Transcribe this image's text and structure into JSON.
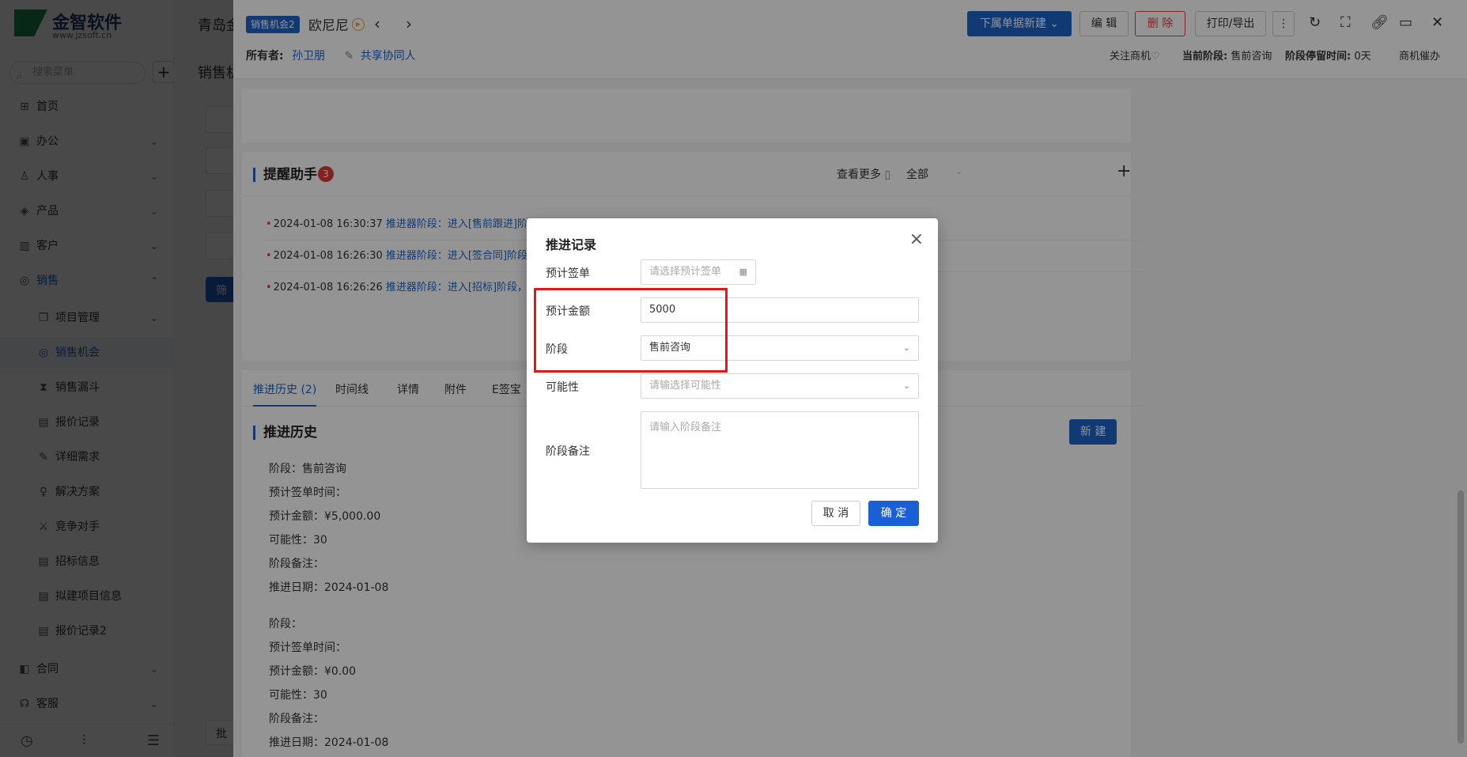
{
  "brand": {
    "name": "金智软件",
    "url": "www.jzsoft.cn"
  },
  "sidebar": {
    "search_placeholder": "搜索菜单",
    "items": [
      {
        "label": "首页",
        "icon": "home-icon",
        "top": 0
      },
      {
        "label": "办公",
        "icon": "briefcase-icon"
      },
      {
        "label": "人事",
        "icon": "people-icon"
      },
      {
        "label": "产品",
        "icon": "box-icon"
      },
      {
        "label": "客户",
        "icon": "chart-icon"
      },
      {
        "label": "销售",
        "icon": "sales-icon"
      },
      {
        "label": "项目管理",
        "icon": "copy-icon"
      },
      {
        "label": "销售机会",
        "icon": "target-icon"
      },
      {
        "label": "销售漏斗",
        "icon": "hourglass-icon"
      },
      {
        "label": "报价记录",
        "icon": "doc-icon"
      },
      {
        "label": "详细需求",
        "icon": "edit-icon"
      },
      {
        "label": "解决方案",
        "icon": "bulb-icon"
      },
      {
        "label": "竞争对手",
        "icon": "swords-icon"
      },
      {
        "label": "招标信息",
        "icon": "doc-icon"
      },
      {
        "label": "拟建项目信息",
        "icon": "doc-icon"
      },
      {
        "label": "报价记录2",
        "icon": "doc-icon"
      },
      {
        "label": "合同",
        "icon": "contract-icon"
      },
      {
        "label": "客服",
        "icon": "service-icon"
      }
    ]
  },
  "bgpage": {
    "title": "青岛金",
    "tab": "销售机",
    "filter_btn": "筛",
    "batch_btn": "批"
  },
  "drawer": {
    "badge": "销售机会2",
    "name": "欧尼尼",
    "buttons": {
      "new_sub": "下属单据新建",
      "edit": "编 辑",
      "delete": "删 除",
      "print": "打印/导出"
    },
    "owner_label": "所有者:",
    "owner_name": "孙卫朋",
    "share_label": "共享协同人",
    "follow_label": "关注商机",
    "stage_label": "当前阶段:",
    "stage_value": "售前咨询",
    "stay_label": "阶段停留时间:",
    "stay_value": "0天",
    "remind_link": "商机催办",
    "reminder": {
      "title": "提醒助手",
      "count": "3",
      "view_more": "查看更多",
      "filter": "全部",
      "items": [
        {
          "time": "2024-01-08 16:30:37",
          "text": "推进器阶段：进入[售前跟进]阶段"
        },
        {
          "time": "2024-01-08 16:26:30",
          "text": "推进器阶段：进入[签合同]阶段,"
        },
        {
          "time": "2024-01-08 16:26:26",
          "text": "推进器阶段：进入[招标]阶段，每"
        }
      ]
    },
    "tabs": [
      "推进历史 (2)",
      "时间线",
      "详情",
      "附件",
      "E签宝"
    ],
    "history": {
      "title": "推进历史",
      "new_button": "新 建",
      "records": [
        [
          "阶段：售前咨询",
          "预计签单时间：",
          "预计金额：¥5,000.00",
          "可能性：30",
          "阶段备注：",
          "推进日期：2024-01-08"
        ],
        [
          "阶段：",
          "预计签单时间：",
          "预计金额：¥0.00",
          "可能性：30",
          "阶段备注：",
          "推进日期：2024-01-08"
        ]
      ]
    }
  },
  "modal": {
    "title": "推进记录",
    "fields": {
      "sign_date_label": "预计签单",
      "sign_date_placeholder": "请选择预计签单",
      "amount_label": "预计金额",
      "amount_value": "5000",
      "stage_label": "阶段",
      "stage_value": "售前咨询",
      "possibility_label": "可能性",
      "possibility_placeholder": "请输选择可能性",
      "note_label": "阶段备注",
      "note_placeholder": "请输入阶段备注"
    },
    "cancel": "取 消",
    "confirm": "确 定"
  },
  "colors": {
    "accent": "#1e62c9",
    "danger": "#e03a3a",
    "highlight": "#e01818"
  }
}
